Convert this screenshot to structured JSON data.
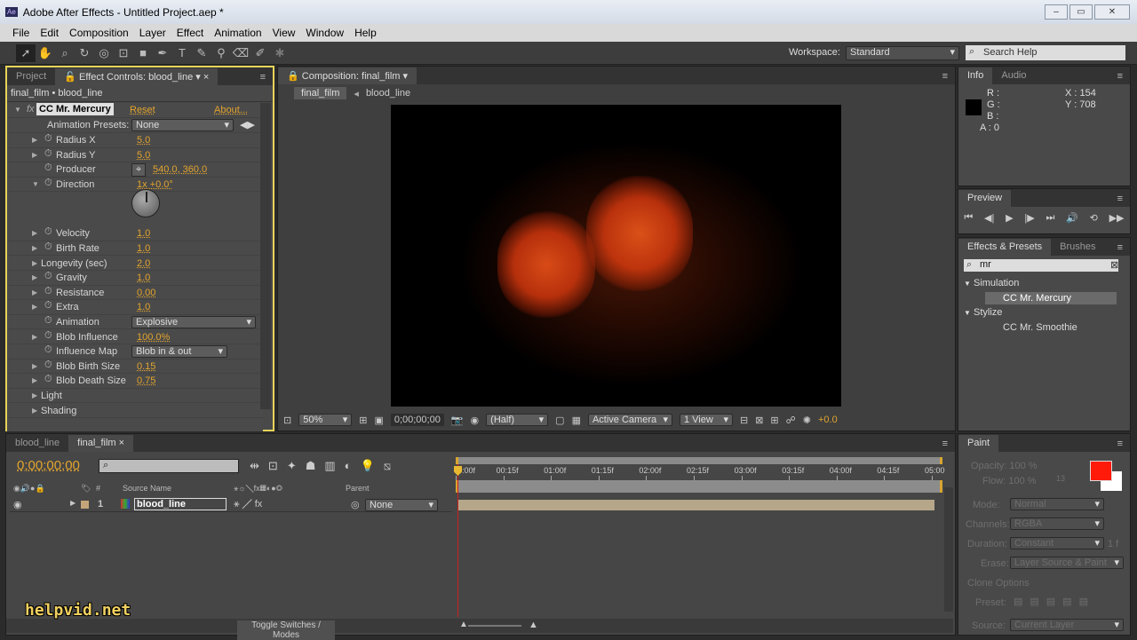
{
  "window": {
    "title": "Adobe After Effects - Untitled Project.aep *",
    "app_icon": "Ae"
  },
  "menu": [
    "File",
    "Edit",
    "Composition",
    "Layer",
    "Effect",
    "Animation",
    "View",
    "Window",
    "Help"
  ],
  "toolbar": {
    "workspace_label": "Workspace:",
    "workspace_value": "Standard",
    "search_placeholder": "Search Help"
  },
  "left_panel": {
    "tabs": [
      "Project",
      "Effect Controls: blood_line"
    ],
    "breadcrumb": "final_film • blood_line",
    "effect_name": "CC Mr. Mercury",
    "reset": "Reset",
    "about": "About...",
    "presets_label": "Animation Presets:",
    "presets_value": "None",
    "params": [
      {
        "label": "Radius X",
        "value": "5.0"
      },
      {
        "label": "Radius Y",
        "value": "5.0"
      },
      {
        "label": "Producer",
        "value": "540.0, 360.0"
      },
      {
        "label": "Direction",
        "value": "1x +0.0°"
      },
      {
        "label": "Velocity",
        "value": "1.0"
      },
      {
        "label": "Birth Rate",
        "value": "1.0"
      },
      {
        "label": "Longevity (sec)",
        "value": "2.0"
      },
      {
        "label": "Gravity",
        "value": "1.0"
      },
      {
        "label": "Resistance",
        "value": "0.00"
      },
      {
        "label": "Extra",
        "value": "1.0"
      },
      {
        "label": "Animation",
        "value": "Explosive"
      },
      {
        "label": "Blob Influence",
        "value": "100.0%"
      },
      {
        "label": "Influence Map",
        "value": "Blob in & out"
      },
      {
        "label": "Blob Birth Size",
        "value": "0.15"
      },
      {
        "label": "Blob Death Size",
        "value": "0.75"
      },
      {
        "label": "Light"
      },
      {
        "label": "Shading"
      }
    ]
  },
  "comp_panel": {
    "tab": "Composition: final_film",
    "crumbs": [
      "final_film",
      "blood_line"
    ],
    "zoom": "50%",
    "timecode": "0;00;00;00",
    "resolution": "(Half)",
    "camera": "Active Camera",
    "views": "1 View",
    "exposure": "+0.0"
  },
  "info": {
    "tabs": [
      "Info",
      "Audio"
    ],
    "r": "R :",
    "g": "G :",
    "b": "B :",
    "a": "A : 0",
    "x": "X : 154",
    "y": "Y : 708"
  },
  "preview": {
    "tab": "Preview"
  },
  "effects_presets": {
    "tabs": [
      "Effects & Presets",
      "Brushes"
    ],
    "search": "mr",
    "groups": [
      {
        "name": "Simulation",
        "items": [
          "CC Mr. Mercury"
        ]
      },
      {
        "name": "Stylize",
        "items": [
          "CC Mr. Smoothie"
        ]
      }
    ]
  },
  "timeline": {
    "tabs": [
      "blood_line",
      "final_film"
    ],
    "timecode": "0;00;00;00",
    "columns": {
      "source": "Source Name",
      "parent": "Parent",
      "num": "#"
    },
    "ticks": [
      "0:00f",
      "00:15f",
      "01:00f",
      "01:15f",
      "02:00f",
      "02:15f",
      "03:00f",
      "03:15f",
      "04:00f",
      "04:15f",
      "05:00"
    ],
    "layers": [
      {
        "num": "1",
        "name": "blood_line",
        "parent": "None"
      }
    ],
    "toggle": "Toggle Switches / Modes"
  },
  "paint": {
    "tab": "Paint",
    "opacity_label": "Opacity:",
    "opacity": "100 %",
    "flow_label": "Flow:",
    "flow": "100 %",
    "brush_size": "13",
    "mode_label": "Mode:",
    "mode": "Normal",
    "channels_label": "Channels:",
    "channels": "RGBA",
    "duration_label": "Duration:",
    "duration": "Constant",
    "duration_frames": "1 f",
    "erase_label": "Erase:",
    "erase": "Layer Source & Paint",
    "clone_label": "Clone Options",
    "preset_label": "Preset:",
    "source_label": "Source:",
    "source": "Current Layer",
    "fg_color": "#ff1a0a",
    "bg_color": "#ffffff"
  },
  "watermark": "helpvid.net",
  "colors": {
    "accent": "#e2a42e",
    "active_border": "#e8d45a",
    "playhead": "#d02020"
  }
}
